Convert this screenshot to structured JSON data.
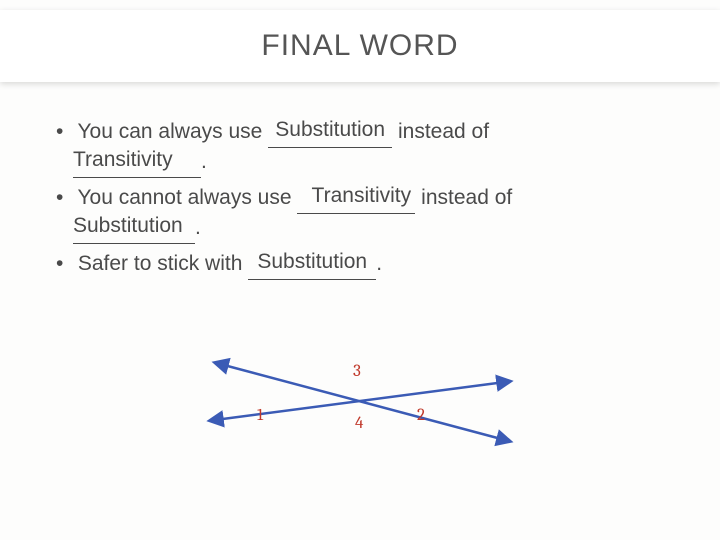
{
  "title": "FINAL WORD",
  "bullets": {
    "b1": {
      "pre": "You can always use ",
      "blank1": "Substitution",
      "mid": " instead of",
      "blank2": "Transitivity",
      "tail": "."
    },
    "b2": {
      "pre": "You cannot always use ",
      "blank1": "Transitivity",
      "mid": " instead of",
      "blank2": "Substitution",
      "tail": "."
    },
    "b3": {
      "pre": "Safer to stick with ",
      "blank1": "Substitution",
      "tail": "."
    }
  },
  "diagram": {
    "labels": {
      "top": "3",
      "bottom": "4",
      "left": "1",
      "right": "2"
    },
    "colors": {
      "line": "#3b5bb5",
      "label": "#c0392b",
      "arrow": "#3b5bb5"
    }
  }
}
